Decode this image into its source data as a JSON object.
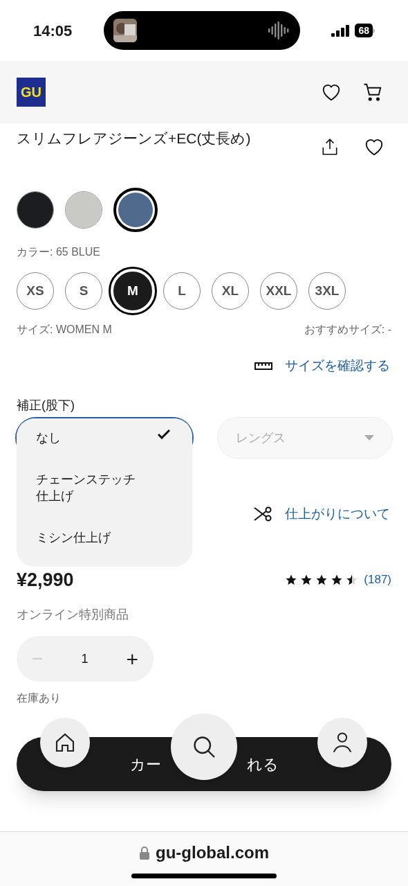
{
  "status_bar": {
    "time": "14:05",
    "battery": "68"
  },
  "header": {
    "logo": "GU"
  },
  "product": {
    "title": "スリムフレアジーンズ+EC(丈長め)"
  },
  "colors": [
    {
      "color": "#1c1d21",
      "selected": false
    },
    {
      "color": "#c9c9c5",
      "selected": false
    },
    {
      "color": "#4f6a8c",
      "selected": true
    }
  ],
  "color_label": "カラー: 65 BLUE",
  "sizes": [
    {
      "label": "XS",
      "selected": false
    },
    {
      "label": "S",
      "selected": false
    },
    {
      "label": "M",
      "selected": true
    },
    {
      "label": "L",
      "selected": false
    },
    {
      "label": "XL",
      "selected": false
    },
    {
      "label": "XXL",
      "selected": false
    },
    {
      "label": "3XL",
      "selected": false
    }
  ],
  "size_label": "サイズ: WOMEN M",
  "recommended_size": "おすすめサイズ: -",
  "size_link": "サイズを確認する",
  "hem": {
    "label": "補正(股下)",
    "options": [
      {
        "label": "なし",
        "selected": true
      },
      {
        "label": "チェーンステッチ仕上げ",
        "selected": false
      },
      {
        "label": "ミシン仕上げ",
        "selected": false
      }
    ],
    "length_select": {
      "placeholder": "レングス",
      "disabled": true
    }
  },
  "finish_link": "仕上がりについて",
  "price": "¥2,990",
  "rating": {
    "stars": 4.5,
    "count": "(187)"
  },
  "online_note": "オンライン特別商品",
  "quantity": {
    "minus": "−",
    "value": "1",
    "plus": "+"
  },
  "stock": "在庫あり",
  "cart_button": {
    "label_start": "カー",
    "label_end": "れる"
  },
  "url_bar": {
    "url": "gu-global.com"
  }
}
